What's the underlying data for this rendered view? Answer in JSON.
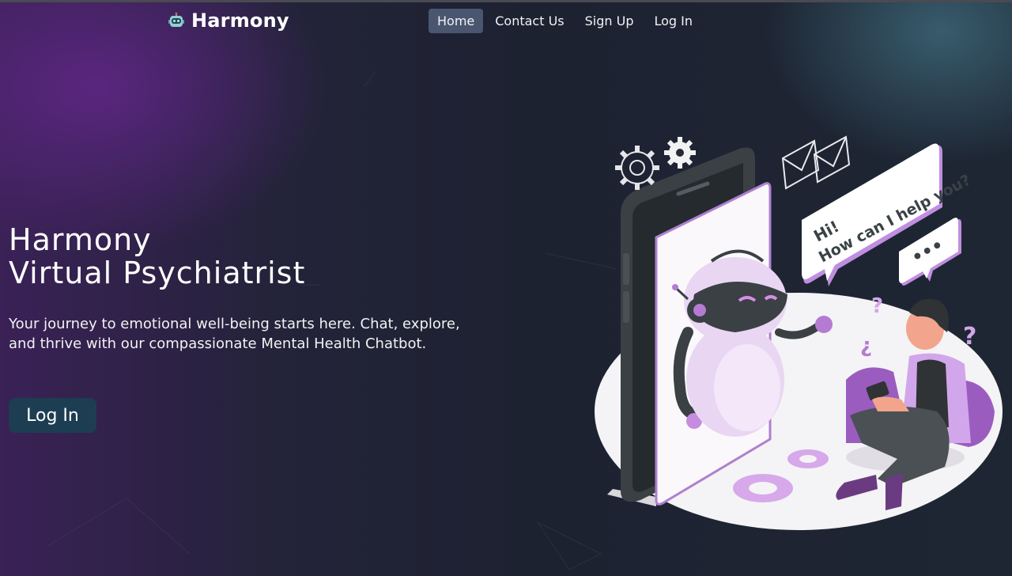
{
  "nav": {
    "brand": "Harmony",
    "links": [
      {
        "label": "Home",
        "active": true
      },
      {
        "label": "Contact Us",
        "active": false
      },
      {
        "label": "Sign Up",
        "active": false
      },
      {
        "label": "Log In",
        "active": false
      }
    ]
  },
  "hero": {
    "title_line1": "Harmony",
    "title_line2": "Virtual Psychiatrist",
    "description": "Your journey to emotional well-being starts here. Chat, explore, and thrive with our compassionate Mental Health Chatbot.",
    "button_label": "Log In"
  },
  "illustration": {
    "bubble_line1": "Hi!",
    "bubble_line2": "How can I help you?",
    "typing_bubble": "•••"
  },
  "icons": {
    "brand": "robot-icon",
    "gear": "gear-icon",
    "envelope": "envelope-icon",
    "chat": "chat-bubble-icon"
  },
  "colors": {
    "accent": "#4a5670",
    "button": "#1d3d53",
    "purple": "#b07fd0",
    "dark_bg": "#1c2230"
  }
}
